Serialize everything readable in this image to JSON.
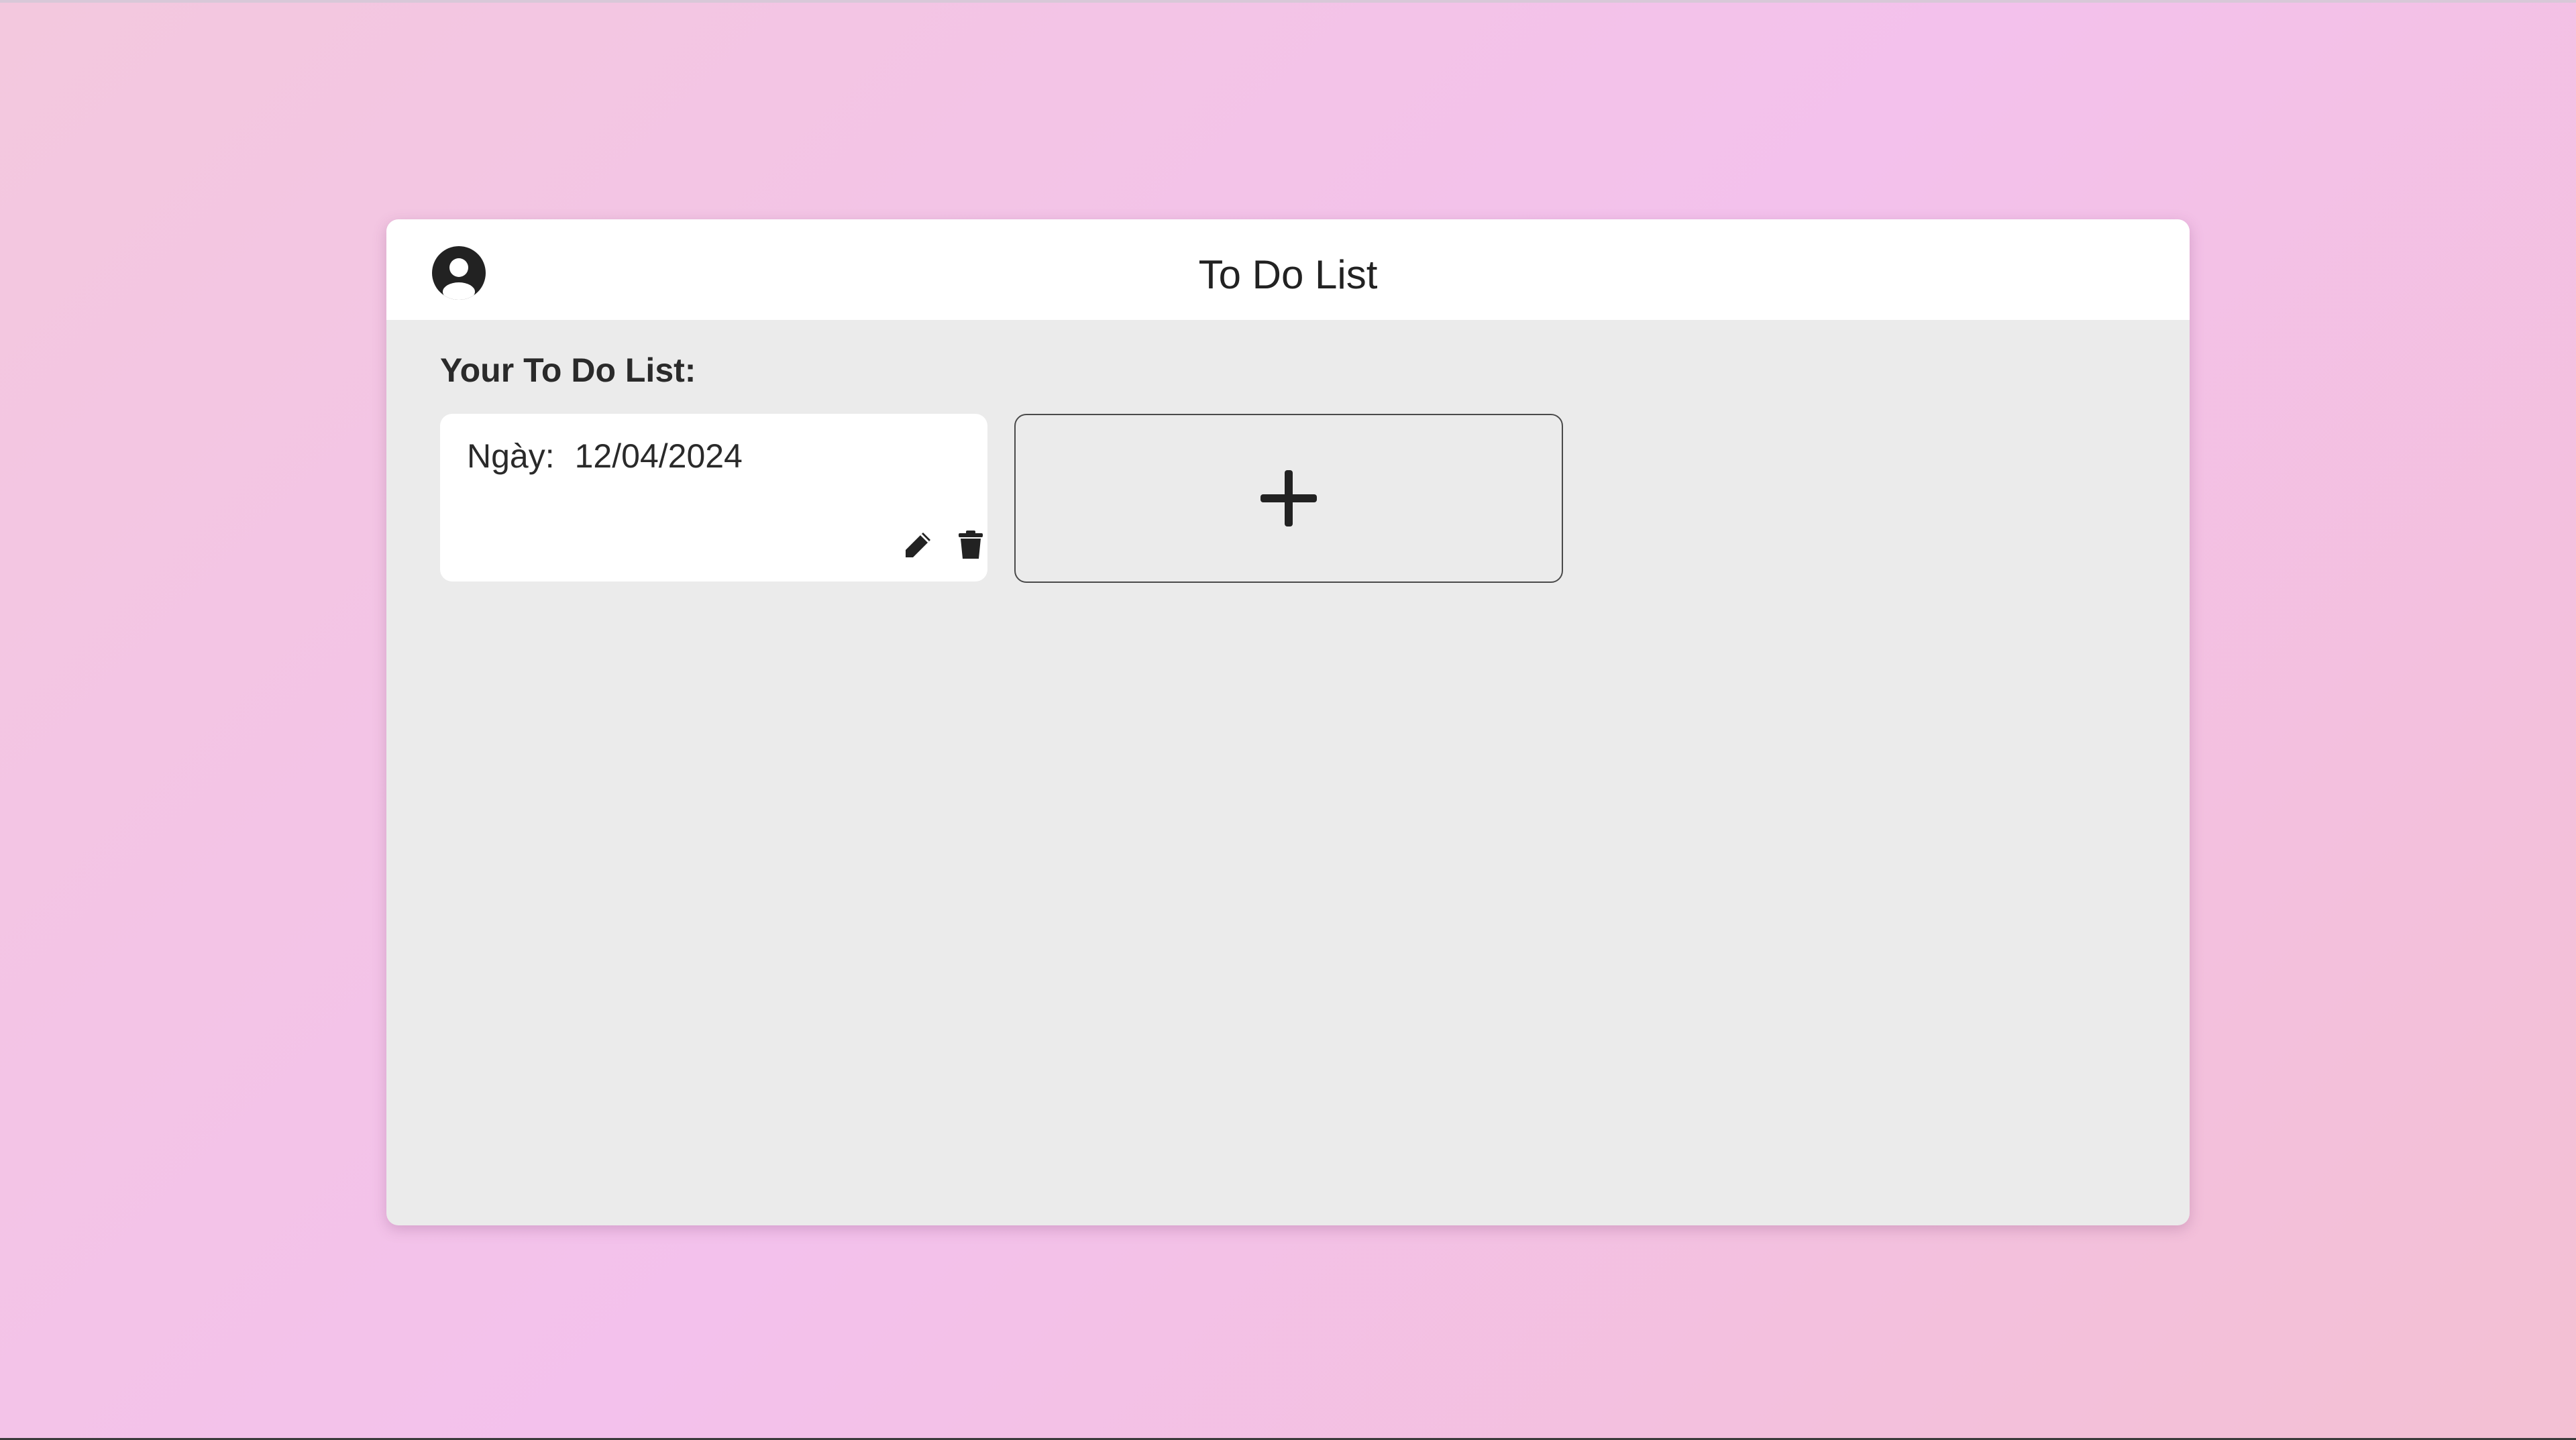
{
  "app": {
    "title": "To Do List",
    "profile_icon": "user-circle-icon"
  },
  "main": {
    "heading": "Your To Do List:",
    "todos": [
      {
        "date_label": "Ngày:",
        "date_value": "12/04/2024",
        "edit_icon": "pencil-icon",
        "delete_icon": "trash-icon"
      }
    ],
    "add_icon": "plus-icon"
  },
  "colors": {
    "background_gradient": [
      "#f3c8de",
      "#f3c1ec",
      "#f3c0d3"
    ],
    "panel": "#ebebeb",
    "header": "#ffffff",
    "card": "#ffffff",
    "icon": "#222222"
  }
}
